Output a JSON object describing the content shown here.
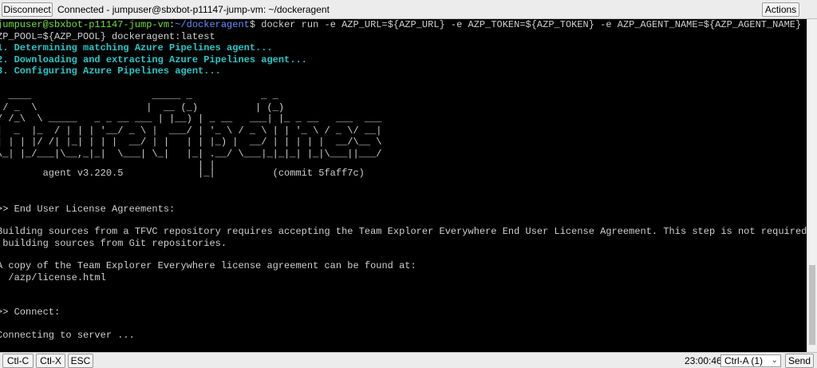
{
  "toolbar": {
    "disconnect_label": "Disconnect",
    "connection_text": "Connected - jumpuser@sbxbot-p11147-jump-vm: ~/dockeragent",
    "actions_label": "Actions"
  },
  "terminal": {
    "prompt_user": "jumpuser@sbxbot-p11147-jump-vm",
    "prompt_sep": ":",
    "prompt_path": "~/dockeragent",
    "command_1": "$ docker run -e AZP_URL=${AZP_URL} -e AZP_TOKEN=${AZP_TOKEN} -e AZP_AGENT_NAME=${AZP_AGENT_NAME} -e A",
    "command_2": "ZP_POOL=${AZP_POOL} dockeragent:latest",
    "step_1": "1. Determining matching Azure Pipelines agent...",
    "step_2": "2. Downloading and extracting Azure Pipelines agent...",
    "step_3": "3. Configuring Azure Pipelines agent...",
    "banner": [
      "  ____                     _____ _            _ _",
      " / _  \\                   |  __ (_)          | (_)",
      "/ /_\\  \\ _____   _ _ __ ___ | |__) | _ __   ___| |_ _ __   ___  ___",
      "|  _  |_  / | | | '__/ _ \\ |  ___/ | '_ \\ / _ \\ | | '_ \\ / _ \\/ __|",
      "| | | |/ /| |_| | | |  __/ | |   | | |_) |  __/ | | | | |  __/\\__ \\",
      "\\_| |_/___|\\__,_|_|  \\___| \\_|   |_| .__/ \\___|_|_|_| |_|\\___||___/",
      "                                   | |",
      "        agent v3.220.5             |_|          (commit 5faff7c)"
    ],
    "eula_heading": ">> End User License Agreements:",
    "eula_text_1": "Building sources from a TFVC repository requires accepting the Team Explorer Everywhere End User License Agreement. This step is not required for",
    "eula_text_2": " building sources from Git repositories.",
    "license_text": "A copy of the Team Explorer Everywhere license agreement can be found at:",
    "license_path": "  /azp/license.html",
    "connect_heading": ">> Connect:",
    "connecting_text": "Connecting to server ..."
  },
  "bottombar": {
    "ctrl_c": "Ctl-C",
    "ctrl_x": "Ctl-X",
    "esc": "ESC",
    "time": "23:00:46",
    "ctrl_a_select": "Ctrl-A (1)",
    "send": "Send"
  }
}
